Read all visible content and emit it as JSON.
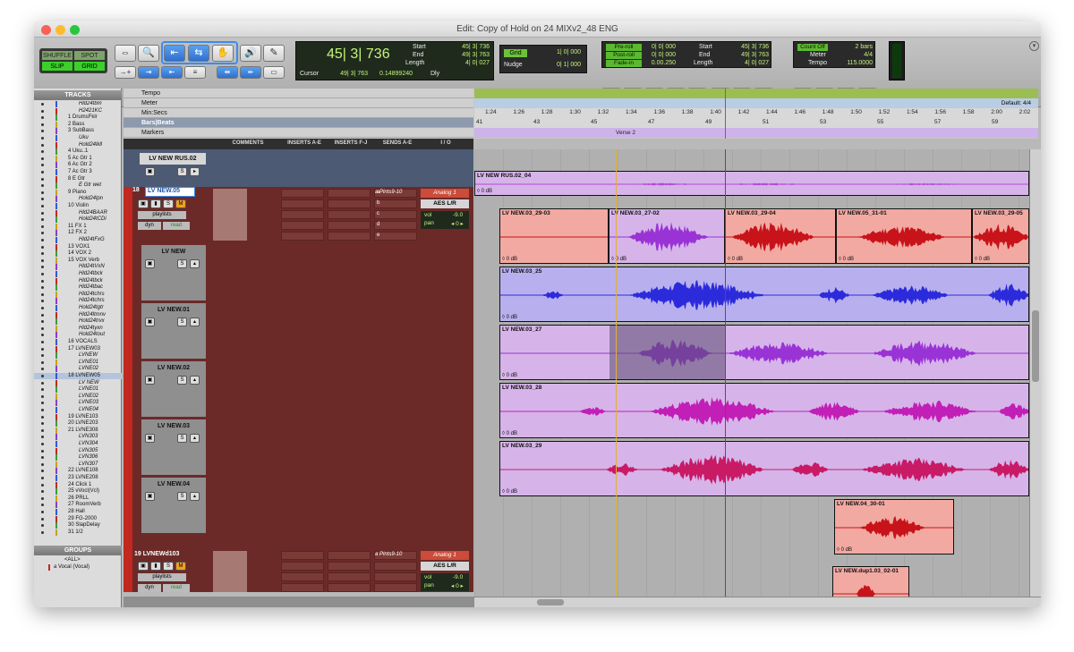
{
  "window": {
    "title": "Edit: Copy of Hold on 24 MIXv2_48 ENG"
  },
  "modes": {
    "shuffle": "SHUFFLE",
    "spot": "SPOT",
    "slip": "SLIP",
    "grid": "GRID"
  },
  "counter": {
    "main": "45| 3| 736",
    "cursor_label": "Cursor",
    "cursor_value": "49| 3| 763",
    "cursor_db": "0.14899240",
    "dly": "Dly",
    "start_label": "Start",
    "start_value": "45| 3| 736",
    "end_label": "End",
    "end_value": "49| 3| 763",
    "length_label": "Length",
    "length_value": "4| 0| 027"
  },
  "grid": {
    "grid_label": "Grid",
    "grid_value": "1| 0| 000",
    "nudge_label": "Nudge",
    "nudge_value": "0| 1| 000"
  },
  "preroll": {
    "pre_label": "Pre-roll",
    "pre_value": "0| 0| 000",
    "post_label": "Post-roll",
    "post_value": "0| 0| 000",
    "fade_label": "Fade-in",
    "fade_value": "0.00.250",
    "start_label": "Start",
    "start_value": "45| 3| 736",
    "end_label": "End",
    "end_value": "49| 3| 763",
    "length_label": "Length",
    "length_value": "4| 0| 027"
  },
  "countoff": {
    "label": "Count Off",
    "value": "2 bars",
    "meter_label": "Meter",
    "meter_value": "4/4",
    "tempo_label": "Tempo",
    "tempo_value": "115.0000"
  },
  "tracks_panel": {
    "header": "TRACKS",
    "rows": [
      "Hld24tbm",
      "H2421KC",
      "1 DrumsFklr",
      "2 Bass",
      "3 SubBass",
      "Uku",
      "Hold24lkll",
      "4 Uku..1",
      "5 Ac Gtr 1",
      "6 Ac Gtr 2",
      "7 Ac Gtr 3",
      "8 E Gtr",
      "E Gtr wet",
      "9 Piano",
      "Hold24lpn",
      "10 Violin",
      "Hld24BAAR",
      "Hold24tCDi",
      "11 FX 1",
      "12 FX 2",
      "Hld24tFxG",
      "13 VOX1",
      "14 VOX 2",
      "15 VOX Verb",
      "Hld24tVxN",
      "Hld24tbck",
      "Hld24tbck",
      "Hld24tbac",
      "Hld24tchrs",
      "Hld24tchrs",
      "Hold24tgtr",
      "Hld24ltmnv",
      "Hold24trvx",
      "Hld24tyxn",
      "Hold24tout",
      "16 VOCALS",
      "17 LVNEW03",
      "LVNEW",
      "LVNE01",
      "LVNE02",
      "18 LVNEW05",
      "LV NEW",
      "LVNE01",
      "LVNE02",
      "LVNE03",
      "LVNE04",
      "19 LVNE103",
      "20 LVNE203",
      "21 LVNE308",
      "LVN303",
      "LVN304",
      "LVN305",
      "LVN306",
      "LVN307",
      "22 LVNE108",
      "23 LVNE208",
      "24 Click 1",
      "25 vVocl(Vcl)",
      "26 PRLL",
      "27 RoomVerb",
      "28 Hall",
      "29 FG-2000",
      "30 SlapDelay",
      "31 1/2"
    ],
    "selected_index": 40
  },
  "groups_panel": {
    "header": "GROUPS",
    "rows": [
      "<ALL>",
      "a  Vocal (Vocal)"
    ]
  },
  "rulers": {
    "tempo": "Tempo",
    "meter": "Meter",
    "minsecs": "Min:Secs",
    "bars": "Bars|Beats",
    "markers": "Markers",
    "meter_default": "Default: 4/4",
    "marker_name": "Verse 2",
    "minsecs_ticks": [
      "1:24",
      "1:26",
      "1:28",
      "1:30",
      "1:32",
      "1:34",
      "1:36",
      "1:38",
      "1:40",
      "1:42",
      "1:44",
      "1:46",
      "1:48",
      "1:50",
      "1:52",
      "1:54",
      "1:56",
      "1:58",
      "2:00",
      "2:02"
    ],
    "bar_ticks": [
      "41",
      "43",
      "45",
      "47",
      "49",
      "51",
      "53",
      "55",
      "57",
      "59"
    ]
  },
  "columns": {
    "comments": "COMMENTS",
    "inserts_ae": "INSERTS A-E",
    "inserts_fj": "INSERTS F-J",
    "sends": "SENDS A-E",
    "io": "I / O"
  },
  "tracks": {
    "rus02": {
      "name": "LV NEW RUS.02",
      "clip": "LV NEW RUS.02_04",
      "db": "0 dB"
    },
    "t18": {
      "num": "18",
      "name": "LV NEW.05",
      "playlists": "playlists",
      "dyn": "dyn",
      "read": "read",
      "insert": "a  Plnts9-10",
      "sends": [
        "a",
        "b",
        "c",
        "d",
        "e"
      ],
      "input": "Analog 1",
      "output": "AES L/R",
      "vol_label": "vol",
      "vol": "-9.0",
      "pan_label": "pan",
      "pan": "◂ 0 ▸",
      "clips": [
        {
          "name": "LV NEW.03_29-03",
          "db": "0 dB"
        },
        {
          "name": "LV NEW.03_27-02",
          "db": "0 dB"
        },
        {
          "name": "LV NEW.03_29-04",
          "db": "0 dB"
        },
        {
          "name": "LV NEW.05_31-01",
          "db": "0 dB"
        },
        {
          "name": "LV NEW.03_29-05",
          "db": "0 dB"
        }
      ]
    },
    "lvnew": {
      "name": "LV NEW",
      "clip": "LV NEW.03_25",
      "db": "0 dB"
    },
    "lvnew01": {
      "name": "LV NEW.01",
      "clip": "LV NEW.03_27",
      "db": "0 dB"
    },
    "lvnew02": {
      "name": "LV NEW.02",
      "clip": "LV NEW.03_28",
      "db": "0 dB"
    },
    "lvnew03": {
      "name": "LV NEW.03",
      "clip": "LV NEW.03_29",
      "db": "0 dB"
    },
    "lvnew04": {
      "name": "LV NEW.04",
      "clip": "LV NEW.04_30-01",
      "db": "0 dB"
    },
    "t19": {
      "num": "19",
      "name": "LVNEWd103",
      "playlists": "playlists",
      "dyn": "dyn",
      "read": "read",
      "insert": "a  Plnts9-10",
      "input": "Analog 1",
      "output": "AES L/R",
      "vol_label": "vol",
      "vol": "-9.0",
      "pan_label": "pan",
      "pan": "◂ 0 ▸",
      "clip": "LV NEW.dup1.03_02-01"
    }
  },
  "colors": {
    "red_clip": "#f2a9a2",
    "red_wave": "#c8131a",
    "blue_clip": "#b8b0ee",
    "blue_wave": "#2c2bdc",
    "purple_clip": "#d6b4ea",
    "purple_wave": "#9a33d6",
    "magenta_wave": "#c21fb6",
    "pink_wave": "#c91a66",
    "sel_bg": "#5a4d6e",
    "track_bg": "#6b2a28",
    "accent_red": "#c1281f"
  }
}
